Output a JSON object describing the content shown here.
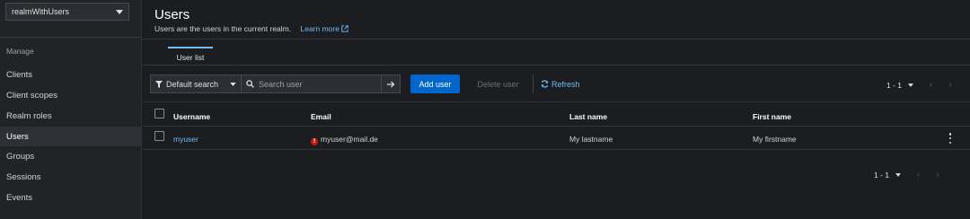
{
  "sidebar": {
    "realm": "realmWithUsers",
    "section_label": "Manage",
    "items": [
      {
        "label": "Clients"
      },
      {
        "label": "Client scopes"
      },
      {
        "label": "Realm roles"
      },
      {
        "label": "Users",
        "active": true
      },
      {
        "label": "Groups"
      },
      {
        "label": "Sessions"
      },
      {
        "label": "Events"
      }
    ]
  },
  "header": {
    "title": "Users",
    "description": "Users are the users in the current realm.",
    "learn_more": "Learn more"
  },
  "tabs": [
    {
      "label": "User list",
      "active": true
    }
  ],
  "toolbar": {
    "filter_label": "Default search",
    "search_placeholder": "Search user",
    "add_label": "Add user",
    "delete_label": "Delete user",
    "refresh_label": "Refresh"
  },
  "pagination": {
    "range": "1 - 1"
  },
  "table": {
    "columns": [
      "Username",
      "Email",
      "Last name",
      "First name"
    ],
    "rows": [
      {
        "username": "myuser",
        "email": "myuser@mail.de",
        "email_unverified": true,
        "last_name": "My lastname",
        "first_name": "My firstname"
      }
    ]
  },
  "colors": {
    "accent": "#0066cc",
    "link": "#73bcf7",
    "warning": "#c9190b",
    "background": "#1b1d21"
  },
  "icons": [
    "caret-down-icon",
    "filter-icon",
    "search-icon",
    "arrow-right-icon",
    "refresh-icon",
    "external-link-icon",
    "exclamation-circle-icon",
    "kebab-icon",
    "angle-left-icon",
    "angle-right-icon"
  ]
}
